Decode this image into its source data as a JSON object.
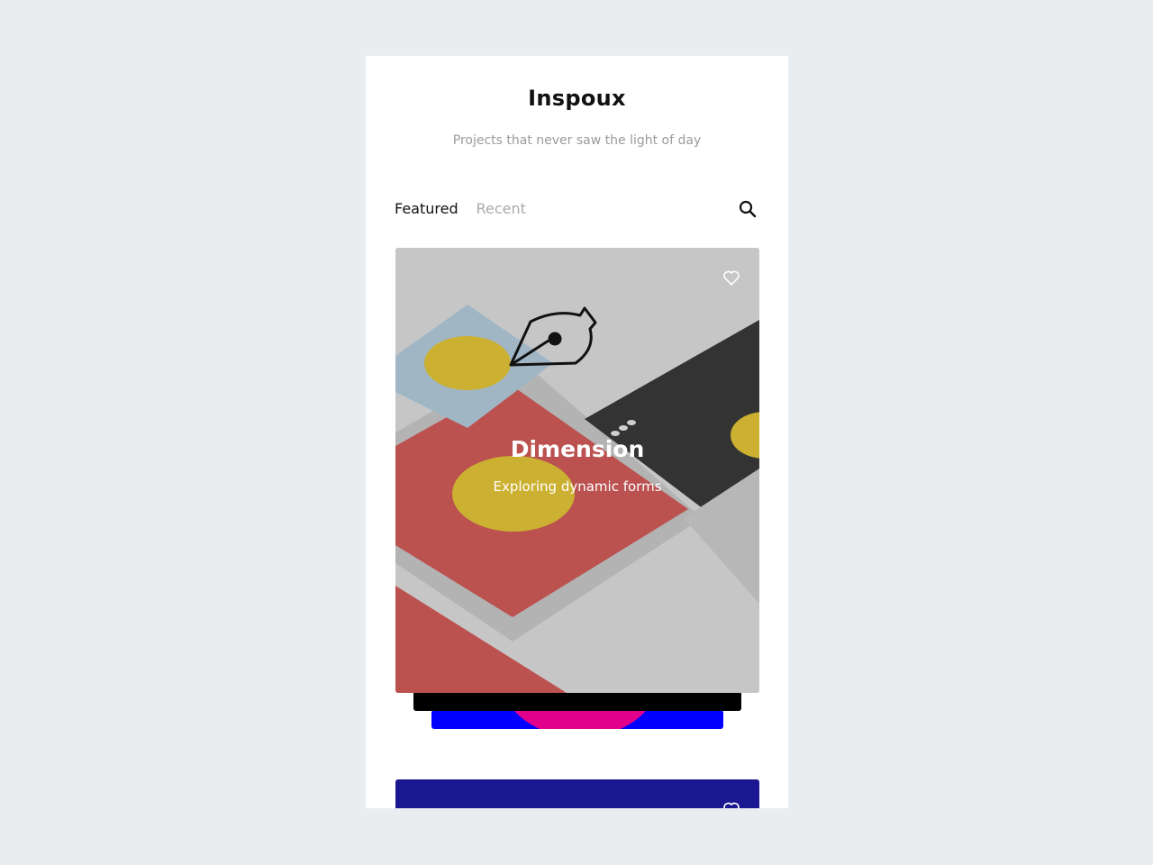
{
  "app": {
    "title": "Inspoux",
    "subtitle": "Projects that never saw the light of day"
  },
  "tabs": [
    {
      "label": "Featured",
      "active": true
    },
    {
      "label": "Recent",
      "active": false
    }
  ],
  "icons": {
    "search": "search-icon",
    "like": "heart-icon"
  },
  "cards": [
    {
      "title": "Dimension",
      "subtitle": "Exploring dynamic forms",
      "background": "#c6c6c6"
    },
    {
      "background": "#1b1790"
    }
  ],
  "stack_colors": {
    "back1": "#000000",
    "back2_blue": "#0000ff",
    "back2_pink": "#e0008c"
  }
}
